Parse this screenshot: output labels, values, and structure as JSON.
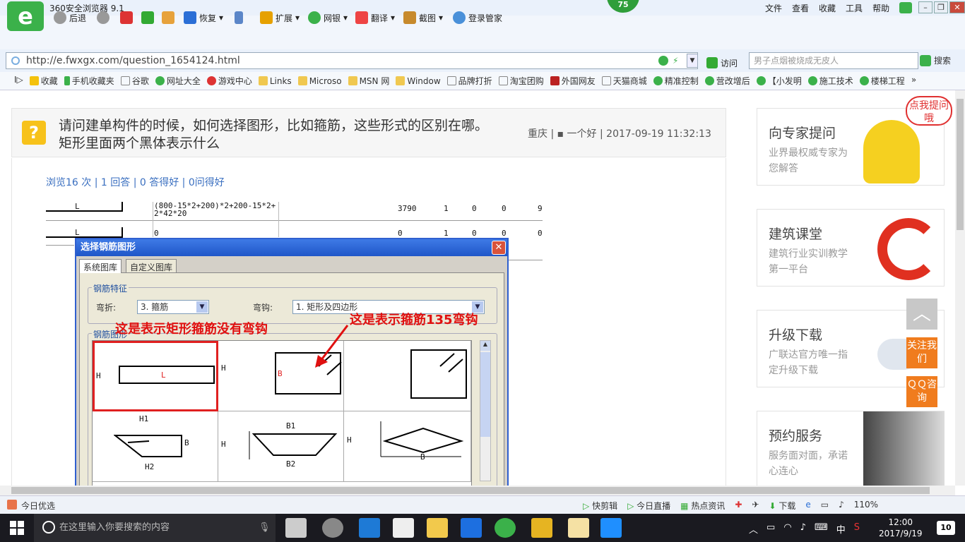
{
  "window": {
    "title": "360安全浏览器 9.1",
    "menu": [
      "文件",
      "查看",
      "收藏",
      "工具",
      "帮助"
    ],
    "score": "75"
  },
  "toolbar": {
    "back": "后退",
    "restore": "恢复",
    "extend": "扩展",
    "bank": "网银",
    "translate": "翻译",
    "screenshot": "截图",
    "login": "登录管家"
  },
  "address": {
    "url": "http://e.fwxgx.com/question_1654124.html",
    "visit": "访问",
    "search_placeholder": "男子点烟被烧成无皮人",
    "search_btn": "搜索"
  },
  "bookmarks": [
    "收藏",
    "手机收藏夹",
    "谷歌",
    "网址大全",
    "游戏中心",
    "Links",
    "Microso",
    "MSN 网",
    "Window",
    "品牌打折",
    "淘宝团购",
    "外国网友",
    "天猫商城",
    "精准控制",
    "营改增后",
    "【小发明",
    "施工技术",
    "楼梯工程"
  ],
  "question": {
    "title": "请问建单构件的时候，如何选择图形，比如箍筋，这些形式的区别在哪。矩形里面两个黑体表示什么",
    "meta": "重庆 | ▪ 一个好 | 2017-09-19 11:32:13",
    "stats": "浏览16 次 | 1 回答 | 0 答得好 | 0问得好"
  },
  "table": {
    "row1": {
      "name": "L",
      "formula1": "(800-15*2+200)*2+200-15*2+",
      "formula2": "2*42*20",
      "v1": "3790",
      "v2": "1",
      "v3": "0",
      "v4": "0",
      "v5": "9"
    },
    "row2": {
      "name": "L",
      "formula": "0",
      "v1": "0",
      "v2": "1",
      "v3": "0",
      "v4": "0",
      "v5": "0"
    }
  },
  "dialog": {
    "title": "选择钢筋图形",
    "tabs": [
      "系统图库",
      "自定义图库"
    ],
    "feature_group": "钢筋特征",
    "bend_label": "弯折:",
    "bend_value": "3. 箍筋",
    "hook_label": "弯钩:",
    "hook_value": "1. 矩形及四边形",
    "shape_group": "钢筋图形",
    "cells": {
      "c1": {
        "h": "H",
        "l": "L",
        "caption": "H1"
      },
      "c2": {
        "h": "H",
        "b": "B",
        "hr": "H"
      },
      "c4": {
        "b": "B",
        "caption": "H2"
      },
      "c5": {
        "h": "H",
        "b1": "B1",
        "b2": "B2"
      },
      "c6": {
        "h": "H",
        "b": "B"
      }
    }
  },
  "annotations": {
    "a1": "这是表示矩形箍筋没有弯钩",
    "a2": "这是表示箍筋135弯钩"
  },
  "sidebar": {
    "cards": [
      {
        "title": "向专家提问",
        "sub": "业界最权威专家为您解答",
        "bubble": "点我提问哦"
      },
      {
        "title": "建筑课堂",
        "sub": "建筑行业实训教学第一平台"
      },
      {
        "title": "升级下载",
        "sub": "广联达官方唯一指定升级下载"
      },
      {
        "title": "预约服务",
        "sub": "服务面对面，承诺心连心"
      }
    ],
    "follow": "关注我们",
    "qq": "ＱＱ咨询"
  },
  "statusbar": {
    "left": "今日优选",
    "items": [
      "快剪辑",
      "今日直播",
      "热点资讯",
      "下载",
      "110%"
    ]
  },
  "taskbar": {
    "search": "在这里输入你要搜索的内容",
    "time": "12:00",
    "date": "2017/9/19",
    "ime": "中",
    "notif": "10"
  }
}
